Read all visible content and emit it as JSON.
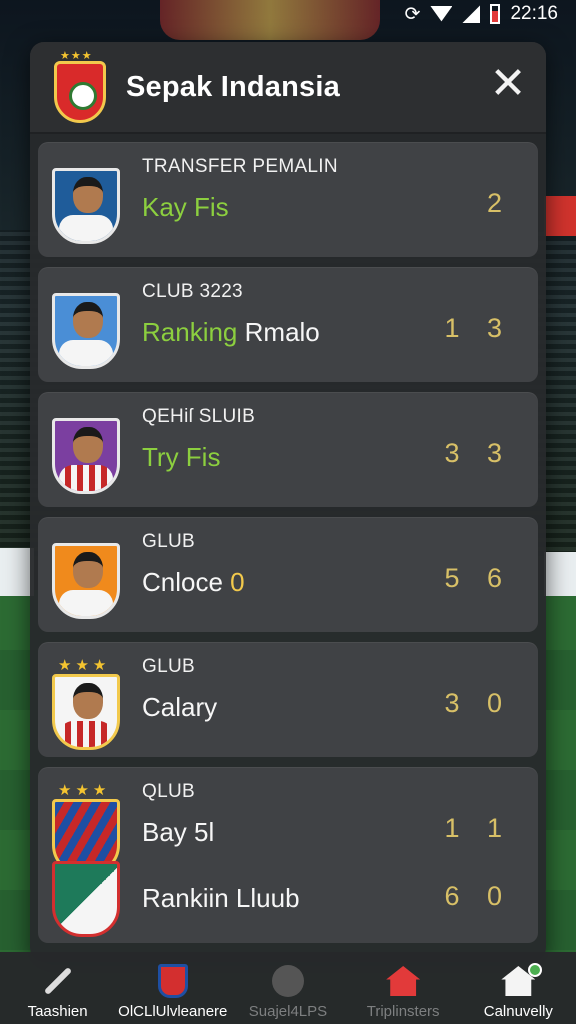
{
  "status_bar": {
    "time": "22:16"
  },
  "header": {
    "title": "Sepak Indansia",
    "close_symbol": "✕"
  },
  "cards": [
    {
      "label": "TRANSFER PEMALIN",
      "name_highlight": "Kay Fis",
      "name_rest": "",
      "name_accent": "",
      "value": "2"
    },
    {
      "label": "CLUB  3223",
      "name_highlight": "Ranking",
      "name_rest": " Rmalo",
      "name_accent": "",
      "value": "1 3"
    },
    {
      "label": "QEHiſ SLUIB",
      "name_highlight": "Try Fis",
      "name_rest": "",
      "name_accent": "",
      "value": "3 3"
    },
    {
      "label": "GLUB",
      "name_highlight": "",
      "name_rest": "Cnloce",
      "name_accent": " 0",
      "value": "5 6"
    },
    {
      "label": "GLUB",
      "name_highlight": "",
      "name_rest": "Calary",
      "name_accent": "",
      "value": "3 0"
    },
    {
      "label": "QLUB",
      "name_highlight": "",
      "name_rest": "Bay 5l",
      "name_accent": "",
      "value": "1 1",
      "sub_name": "Rankiin Lluub",
      "sub_value": "6 0"
    }
  ],
  "bottom_nav": [
    {
      "label": "Taashien",
      "icon": "slash-icon"
    },
    {
      "label": "OlCLlUlvleanere",
      "icon": "club-crest-icon"
    },
    {
      "label": "Suajel4LPS",
      "icon": "circle-icon"
    },
    {
      "label": "Triplinsters",
      "icon": "house-icon"
    },
    {
      "label": "Calnuvelly",
      "icon": "home-icon"
    }
  ],
  "colors": {
    "highlight_green": "#8ccf3f",
    "value_gold": "#d8c067",
    "panel_bg": "#282a2c"
  }
}
